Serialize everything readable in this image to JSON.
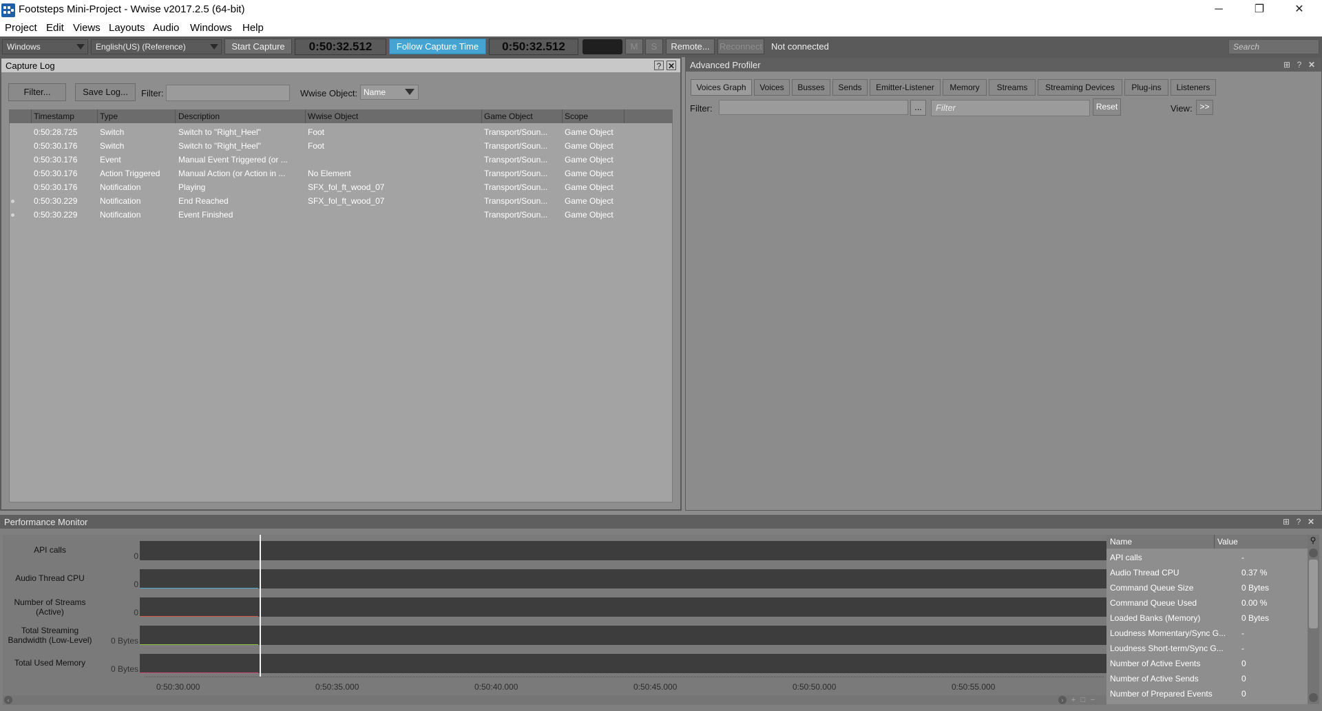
{
  "window": {
    "title": "Footsteps Mini-Project - Wwise v2017.2.5 (64-bit)",
    "minimize": "─",
    "restore": "❐",
    "close": "✕"
  },
  "menu": [
    "Project",
    "Edit",
    "Views",
    "Layouts",
    "Audio",
    "Windows",
    "Help"
  ],
  "toolbar": {
    "platform": "Windows",
    "language": "English(US) (Reference)",
    "start_capture": "Start Capture",
    "capture_time": "0:50:32.512",
    "follow": "Follow Capture Time",
    "follow_time": "0:50:32.512",
    "mute": "M",
    "solo": "S",
    "remote": "Remote...",
    "reconnect": "Reconnect",
    "status": "Not connected",
    "search_placeholder": "Search"
  },
  "capture_log": {
    "title": "Capture Log",
    "help": "?",
    "close": "✕",
    "filter_btn": "Filter...",
    "save_log": "Save Log...",
    "filter_label": "Filter:",
    "wwise_object_label": "Wwise Object:",
    "wwise_object_value": "Name",
    "columns": [
      "Timestamp",
      "Type",
      "Description",
      "Wwise Object",
      "Game Object",
      "Scope"
    ],
    "rows": [
      {
        "marker": false,
        "timestamp": "0:50:28.725",
        "type": "Switch",
        "description": "Switch to \"Right_Heel\"",
        "wwise_object": "Foot",
        "game_object": "Transport/Soun...",
        "scope": "Game Object"
      },
      {
        "marker": false,
        "timestamp": "0:50:30.176",
        "type": "Switch",
        "description": "Switch to \"Right_Heel\"",
        "wwise_object": "Foot",
        "game_object": "Transport/Soun...",
        "scope": "Game Object"
      },
      {
        "marker": false,
        "timestamp": "0:50:30.176",
        "type": "Event",
        "description": "Manual Event Triggered (or ...",
        "wwise_object": "",
        "game_object": "Transport/Soun...",
        "scope": "Game Object"
      },
      {
        "marker": false,
        "timestamp": "0:50:30.176",
        "type": "Action Triggered",
        "description": "Manual Action (or Action in ...",
        "wwise_object": "No Element",
        "game_object": "Transport/Soun...",
        "scope": "Game Object"
      },
      {
        "marker": false,
        "timestamp": "0:50:30.176",
        "type": "Notification",
        "description": "Playing",
        "wwise_object": "SFX_fol_ft_wood_07",
        "game_object": "Transport/Soun...",
        "scope": "Game Object"
      },
      {
        "marker": true,
        "timestamp": "0:50:30.229",
        "type": "Notification",
        "description": "End Reached",
        "wwise_object": "SFX_fol_ft_wood_07",
        "game_object": "Transport/Soun...",
        "scope": "Game Object"
      },
      {
        "marker": true,
        "timestamp": "0:50:30.229",
        "type": "Notification",
        "description": "Event Finished",
        "wwise_object": "",
        "game_object": "Transport/Soun...",
        "scope": "Game Object"
      }
    ]
  },
  "advanced_profiler": {
    "title": "Advanced Profiler",
    "help": "?",
    "close": "✕",
    "tabs": [
      "Voices Graph",
      "Voices",
      "Busses",
      "Sends",
      "Emitter-Listener",
      "Memory",
      "Streams",
      "Streaming Devices",
      "Plug-ins",
      "Listeners"
    ],
    "filter_label": "Filter:",
    "browse": "...",
    "filter_placeholder": "Filter",
    "reset": "Reset",
    "view_label": "View:",
    "view_btn": ">>"
  },
  "performance_monitor": {
    "title": "Performance Monitor",
    "help": "?",
    "close": "✕",
    "graphs": [
      {
        "label": "API calls",
        "zero": "0",
        "color": "#3d3d3d"
      },
      {
        "label": "Audio Thread CPU",
        "zero": "0",
        "color": "#4fa8c8"
      },
      {
        "label": "Number of Streams (Active)",
        "zero": "0",
        "color": "#d25a4a"
      },
      {
        "label": "Total Streaming Bandwidth (Low-Level)",
        "zero": "0 Bytes",
        "color": "#8cc43c"
      },
      {
        "label": "Total Used Memory",
        "zero": "0 Bytes",
        "color": "#d0487a"
      }
    ],
    "time_axis": [
      "0:50:30.000",
      "0:50:35.000",
      "0:50:40.000",
      "0:50:45.000",
      "0:50:50.000",
      "0:50:55.000"
    ],
    "cursor_fraction": 0.122,
    "stats_columns": [
      "Name",
      "Value"
    ],
    "stats": [
      {
        "name": "API calls",
        "value": "-"
      },
      {
        "name": "Audio Thread CPU",
        "value": "0.37 %"
      },
      {
        "name": "Command Queue Size",
        "value": "0 Bytes"
      },
      {
        "name": "Command Queue Used",
        "value": "0.00 %"
      },
      {
        "name": "Loaded Banks (Memory)",
        "value": "0 Bytes"
      },
      {
        "name": "Loudness Momentary/Sync G...",
        "value": "-"
      },
      {
        "name": "Loudness Short-term/Sync G...",
        "value": "-"
      },
      {
        "name": "Number of Active Events",
        "value": "0"
      },
      {
        "name": "Number of Active Sends",
        "value": "0"
      },
      {
        "name": "Number of Prepared Events",
        "value": "0"
      }
    ]
  }
}
